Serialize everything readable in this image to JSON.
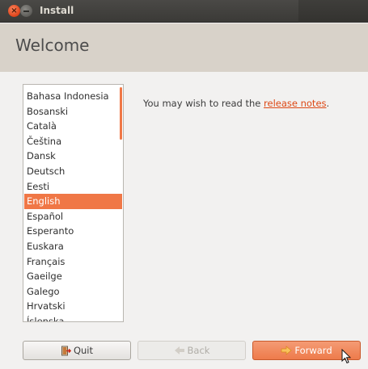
{
  "window": {
    "title": "Install"
  },
  "header": {
    "title": "Welcome"
  },
  "languages": {
    "items": [
      "Bahasa Indonesia",
      "Bosanski",
      "Català",
      "Čeština",
      "Dansk",
      "Deutsch",
      "Eesti",
      "English",
      "Español",
      "Esperanto",
      "Euskara",
      "Français",
      "Gaeilge",
      "Galego",
      "Hrvatski",
      "Íslenska"
    ],
    "selected": "English"
  },
  "notes": {
    "prefix": "You may wish to read the ",
    "link": "release notes",
    "suffix": "."
  },
  "buttons": {
    "quit": "Quit",
    "back": "Back",
    "forward": "Forward"
  },
  "colors": {
    "accent": "#f07746",
    "link": "#dd4814",
    "header_bg": "#d8d2c9"
  },
  "icons": {
    "quit": "exit-door-icon",
    "back": "arrow-left-icon",
    "forward": "arrow-right-icon"
  }
}
